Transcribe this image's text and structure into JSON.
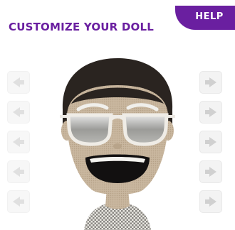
{
  "header": {
    "title": "CUSTOMIZE YOUR DOLL",
    "help_label": "HELP"
  },
  "colors": {
    "brand_purple": "#6a1fa0",
    "help_bg": "#6a1fa0",
    "arrow_bg": "#f1f1f1",
    "arrow_glyph": "#c8c8c8",
    "hair": "#2a2420",
    "skin": "#c9b79f",
    "mouth": "#121010",
    "shirt": "#e4e2dc"
  },
  "controls": {
    "left_arrows": [
      "arrow-left-icon",
      "arrow-left-icon",
      "arrow-left-icon",
      "arrow-left-icon",
      "arrow-left-icon"
    ],
    "right_arrows": [
      "arrow-right-icon",
      "arrow-right-icon",
      "arrow-right-icon",
      "arrow-right-icon",
      "arrow-right-icon"
    ]
  },
  "doll": {
    "accessory": "sunglasses"
  }
}
